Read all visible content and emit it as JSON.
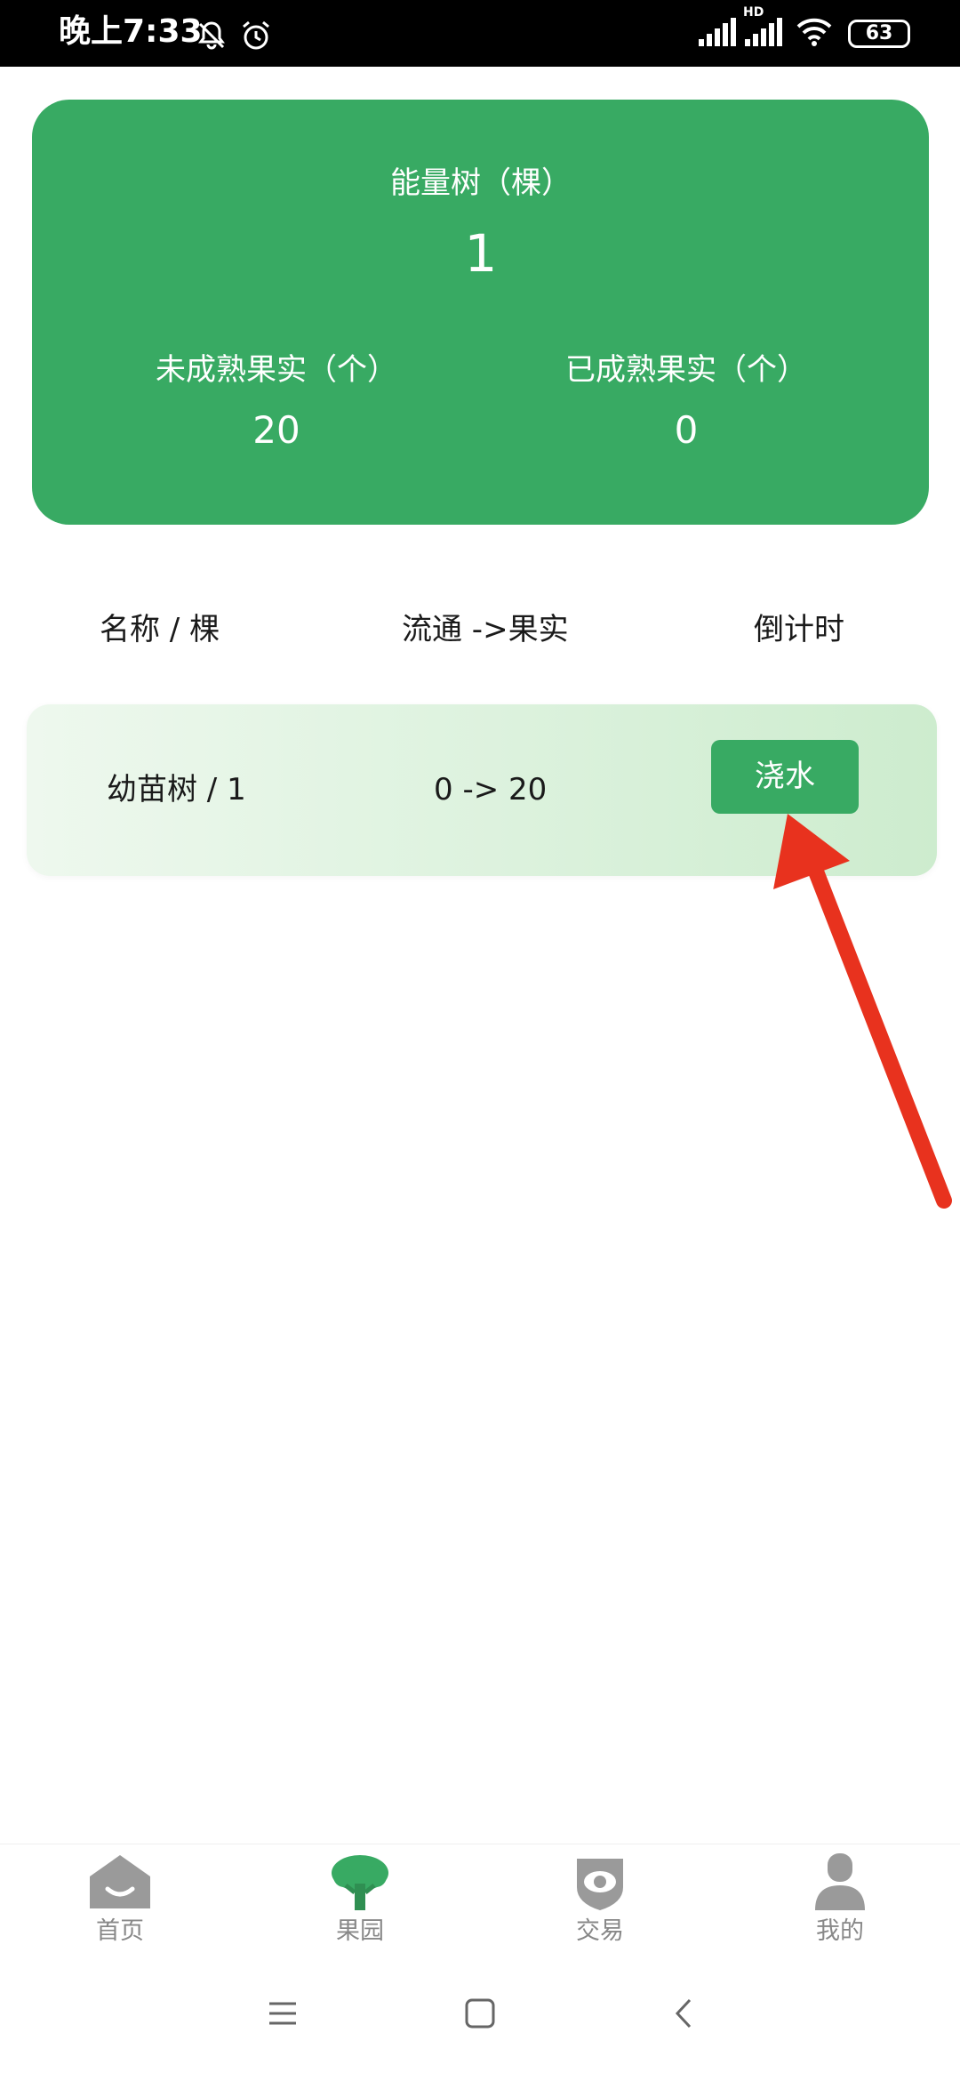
{
  "status_bar": {
    "time": "晚上7:33",
    "battery": "63",
    "network_label": "HD"
  },
  "summary": {
    "trees_label": "能量树（棵）",
    "trees_value": "1",
    "unripe_label": "未成熟果实（个）",
    "unripe_value": "20",
    "ripe_label": "已成熟果实（个）",
    "ripe_value": "0"
  },
  "table": {
    "headers": [
      "名称 / 棵",
      "流通 ->果实",
      "倒计时"
    ],
    "rows": [
      {
        "name": "幼苗树 / 1",
        "flow": "0 -> 20",
        "action_label": "浇水"
      }
    ]
  },
  "tabs": [
    {
      "label": "首页",
      "icon": "home-icon",
      "active": false
    },
    {
      "label": "果园",
      "icon": "tree-icon",
      "active": true
    },
    {
      "label": "交易",
      "icon": "eye-shield-icon",
      "active": false
    },
    {
      "label": "我的",
      "icon": "user-icon",
      "active": false
    }
  ],
  "colors": {
    "accent": "#38aa63",
    "tab_inactive": "#888888",
    "annotation_arrow": "#e8321e"
  }
}
